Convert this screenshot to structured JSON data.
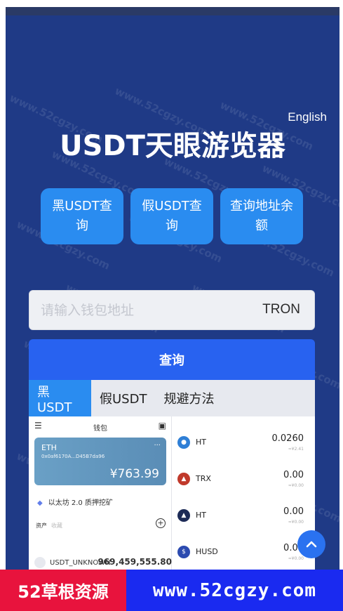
{
  "header": {
    "language": "English",
    "title": "USDT天眼游览器"
  },
  "query_buttons": [
    "黑USDT查询",
    "假USDT查询",
    "查询地址余额"
  ],
  "search": {
    "placeholder": "请输入钱包地址",
    "network": "TRON",
    "submit_label": "查询"
  },
  "tabs": [
    {
      "label": "黑USDT",
      "active": true
    },
    {
      "label": "假USDT",
      "active": false
    },
    {
      "label": "规避方法",
      "active": false
    }
  ],
  "preview": {
    "wallet_title": "钱包",
    "card": {
      "name": "ETH",
      "address": "0x0af6170A...D45B7da96",
      "balance": "¥763.99"
    },
    "stake_label": "以太坊 2.0 质押挖矿",
    "assets_label": "资产",
    "assets_sub": "收藏",
    "token": {
      "name": "USDT_UNKNOWN",
      "value": "969,459,555.80"
    },
    "coins": [
      {
        "name": "HT",
        "value": "0.0260",
        "sub": "≈¥2.41",
        "color": "#2f7fd6",
        "icon": "drop-icon"
      },
      {
        "name": "TRX",
        "value": "0.00",
        "sub": "≈¥0.00",
        "color": "#c0392b",
        "icon": "trx-icon"
      },
      {
        "name": "HT",
        "value": "0.00",
        "sub": "≈¥0.00",
        "color": "#1d2b57",
        "icon": "flame-icon"
      },
      {
        "name": "HUSD",
        "value": "0.00",
        "sub": "≈¥0.00",
        "color": "#2c4bb0",
        "icon": "husd-icon"
      }
    ]
  },
  "banner": {
    "left": "52草根资源",
    "right": "www.52cgzy.com"
  },
  "watermark_text": "www.52cgzy.com",
  "colors": {
    "background": "#1f3a86",
    "button": "#2a8cf0",
    "query": "#2862f0",
    "banner_red": "#e8133d",
    "banner_blue": "#1a2af0"
  }
}
